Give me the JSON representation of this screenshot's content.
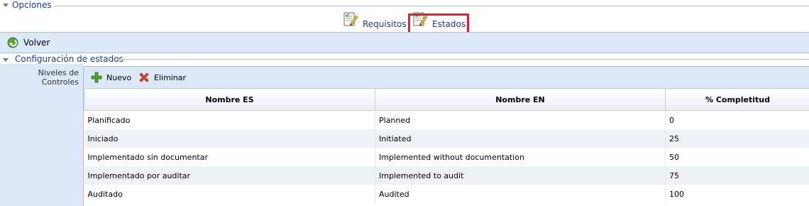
{
  "opciones": {
    "title": "Opciones",
    "tabs": [
      {
        "label": "Requisitos"
      },
      {
        "label": "Estados"
      }
    ]
  },
  "toolbar": {
    "volver_label": "Volver"
  },
  "config": {
    "title": "Configuración de estados",
    "side_label_1": "Niveles de",
    "side_label_2": "Controles",
    "nuevo_label": "Nuevo",
    "eliminar_label": "Eliminar",
    "columns": [
      "Nombre ES",
      "Nombre EN",
      "% Completitud"
    ],
    "rows": [
      [
        "Planificado",
        "Planned",
        "0"
      ],
      [
        "Iniciado",
        "Initiated",
        "25"
      ],
      [
        "Implementado sin documentar",
        "Implemented without documentation",
        "50"
      ],
      [
        "Implementado por auditar",
        "Implemented to audit",
        "75"
      ],
      [
        "Auditado",
        "Audited",
        "100"
      ]
    ]
  },
  "colors": {
    "accent": "#1f3a8a",
    "panel": "#dbe8f7",
    "highlight": "#e0202e"
  }
}
